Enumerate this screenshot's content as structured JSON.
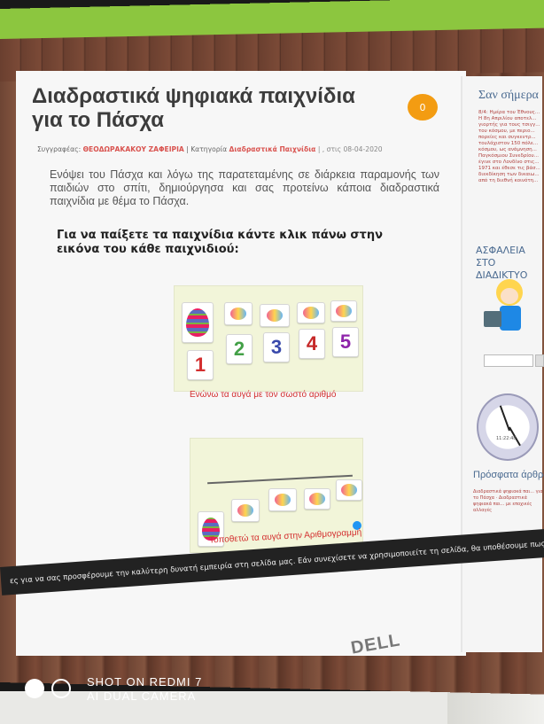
{
  "post": {
    "title": "Διαδραστικά ψηφιακά παιχνίδια για το Πάσχα",
    "comment_count": "0",
    "meta": {
      "author_label": "Συγγραφέας:",
      "author": "ΘΕΟΔΩΡΑΚΑΚΟΥ ΖΑΦΕΙΡΙΑ",
      "category_label": "| Κατηγορία",
      "category": "Διαδραστικά Παιχνίδια",
      "date": "| , στις 08-04-2020"
    },
    "intro": "Ενόψει του Πάσχα και λόγω της παρατεταμένης σε διάρκεια παραμονής των παιδιών στο σπίτι, δημιούργησα και σας προτείνω κάποια διαδραστικά παιχνίδια με θέμα το Πάσχα.",
    "instruction": "Για να παίξετε τα παιχνίδια κάντε κλικ πάνω στην εικόνα του κάθε παιχνιδιού:"
  },
  "games": [
    {
      "numbers": [
        "1",
        "2",
        "3",
        "4",
        "5"
      ],
      "number_colors": [
        "#d32f2f",
        "#43a047",
        "#3949ab",
        "#c62828",
        "#8e24aa"
      ],
      "caption": "Ενώνω τα αυγά με τον σωστό αριθμό"
    },
    {
      "caption": "Τοποθετώ τα αυγά στην Αριθμογραμμή"
    }
  ],
  "sidebar": {
    "today_title": "Σαν σήμερα",
    "today_text": "8/4: Ημέρα του Έθνους... Η 8η Απριλίου αποτελ... γιορτής για τους τσιγγ... του κόσμου, με περιο... πορείες και συγκεντρ... τουλάχιστον 150 πόλε... κόσμου, ως ανάμνηση... Παγκόσμιου Συνεδρίου... έγινε στο Λονδίνο στις... 1971 και έθεσε τις βάσ... διεκδίκηση των δικαιω... από τη διεθνή κοινότη...",
    "safety_title": "ΑΣΦΑΛΕΙΑ ΣΤΟ ΔΙΑΔΙΚΤΥΟ",
    "clock_digital": "11:22:48",
    "recent_title": "Πρόσφατα άρθρα",
    "recent_items": "Διαδραστικά ψηφιακά παι... για το Πάσχα · Διαδραστικά ψηφιακά παι... με εποχικές αλλαγές"
  },
  "cookie_bar": "ες για να σας προσφέρουμε την καλύτερη δυνατή εμπειρία στη σελίδα μας. Εάν συνεχίσετε να χρησιμοποιείτε τη σελίδα, θα υποθέσουμε πως είστε ευχαριστημένοι",
  "monitor_brand": "DELL",
  "camera_watermark": {
    "line1": "SHOT ON REDMI 7",
    "line2": "AI DUAL CAMERA"
  }
}
